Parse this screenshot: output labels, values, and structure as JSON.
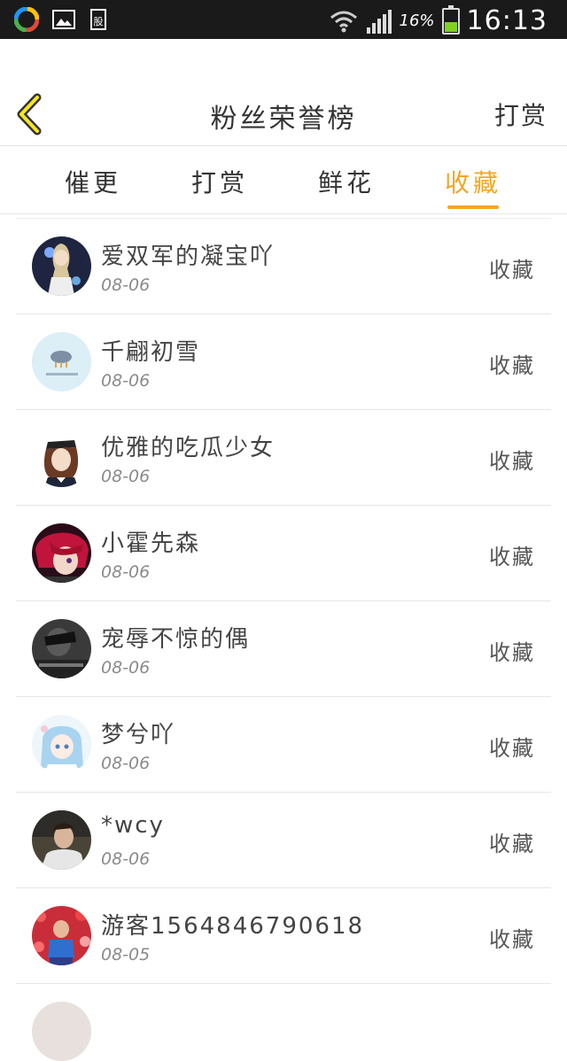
{
  "status_bar": {
    "icons": [
      "app-circle-icon",
      "image-icon",
      "stock-icon"
    ],
    "wifi_icon": "wifi-icon",
    "signal_icon": "signal-icon",
    "battery_percent": "16%",
    "time": "16:13",
    "battery_level": 0.16
  },
  "header": {
    "title": "粉丝荣誉榜",
    "right_action": "打赏",
    "back_icon": "chevron-left-icon"
  },
  "tabs": [
    {
      "label": "催更"
    },
    {
      "label": "打赏"
    },
    {
      "label": "鲜花"
    },
    {
      "label": "收藏",
      "active": true
    }
  ],
  "list": [
    {
      "name": "爱双军的凝宝吖",
      "date": "08-06",
      "action": "收藏",
      "avatar": "anime-character-avatar"
    },
    {
      "name": "千翩初雪",
      "date": "08-06",
      "action": "收藏",
      "avatar": "light-blue-avatar"
    },
    {
      "name": "优雅的吃瓜少女",
      "date": "08-06",
      "action": "收藏",
      "avatar": "sailor-girl-avatar"
    },
    {
      "name": "小霍先森",
      "date": "08-06",
      "action": "收藏",
      "avatar": "red-hair-avatar"
    },
    {
      "name": "宠辱不惊的偶",
      "date": "08-06",
      "action": "收藏",
      "avatar": "dark-photo-avatar"
    },
    {
      "name": "梦兮吖",
      "date": "08-06",
      "action": "收藏",
      "avatar": "anime-blue-hair-avatar"
    },
    {
      "name": "*wcy",
      "date": "08-06",
      "action": "收藏",
      "avatar": "man-photo-avatar"
    },
    {
      "name": "游客1564846790618",
      "date": "08-05",
      "action": "收藏",
      "avatar": "flowers-photo-avatar"
    }
  ],
  "colors": {
    "accent": "#f5a623",
    "status_bar_bg": "#1a1a1a",
    "divider": "#e6e6e6"
  }
}
